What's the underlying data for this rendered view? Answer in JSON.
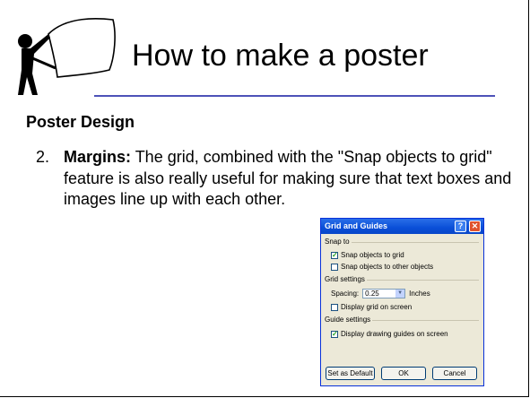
{
  "slide": {
    "title": "How to make a poster",
    "section_heading": "Poster Design",
    "item": {
      "number": "2.",
      "term": "Margins:",
      "text": " The grid, combined with the \"Snap objects to grid\" feature is also really useful for making sure that text boxes and images line up with each other."
    }
  },
  "dialog": {
    "title": "Grid and Guides",
    "help_label": "?",
    "close_label": "✕",
    "snap_to": {
      "label": "Snap to",
      "snap_objects_to_grid": "Snap objects to grid",
      "snap_objects_to_grid_checked": true,
      "snap_objects_to_other": "Snap objects to other objects",
      "snap_objects_to_other_checked": false
    },
    "grid_settings": {
      "label": "Grid settings",
      "spacing_label": "Spacing:",
      "spacing_value": "0.25",
      "spacing_unit": "Inches",
      "display_grid": "Display grid on screen",
      "display_grid_checked": false
    },
    "guide_settings": {
      "label": "Guide settings",
      "display_guides": "Display drawing guides on screen",
      "display_guides_checked": true
    },
    "buttons": {
      "set_default": "Set as Default",
      "ok": "OK",
      "cancel": "Cancel"
    }
  },
  "colors": {
    "rule": "#4d52b8",
    "dialog_title": "#0a4fd8",
    "dialog_bg": "#ece9d8"
  }
}
